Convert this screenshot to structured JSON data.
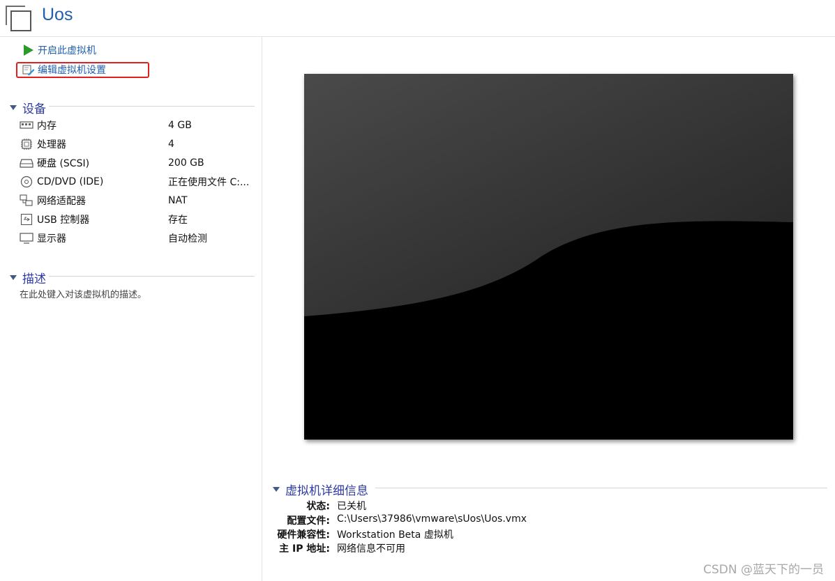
{
  "header": {
    "title": "Uos",
    "icon": "vm-library-icon"
  },
  "actions": [
    {
      "label": "开启此虚拟机",
      "icon": "play-icon"
    },
    {
      "label": "编辑虚拟机设置",
      "icon": "edit-settings-icon",
      "highlighted": true,
      "highlight_color": "#e0201e"
    }
  ],
  "devices": {
    "title": "设备",
    "items": [
      {
        "name": "内存",
        "value": "4 GB",
        "icon": "memory-icon"
      },
      {
        "name": "处理器",
        "value": "4",
        "icon": "cpu-icon"
      },
      {
        "name": "硬盘 (SCSI)",
        "value": "200 GB",
        "icon": "harddisk-icon"
      },
      {
        "name": "CD/DVD (IDE)",
        "value": "正在使用文件 C:...",
        "icon": "cd-dvd-icon"
      },
      {
        "name": "网络适配器",
        "value": "NAT",
        "icon": "network-adapter-icon"
      },
      {
        "name": "USB 控制器",
        "value": "存在",
        "icon": "usb-icon"
      },
      {
        "name": "显示器",
        "value": "自动检测",
        "icon": "monitor-icon"
      }
    ]
  },
  "description": {
    "title": "描述",
    "text": "在此处键入对该虚拟机的描述。"
  },
  "details": {
    "title": "虚拟机详细信息",
    "rows": [
      {
        "label": "状态:",
        "value": "已关机"
      },
      {
        "label": "配置文件:",
        "value": "C:\\Users\\37986\\vmware\\sUos\\Uos.vmx"
      },
      {
        "label": "硬件兼容性:",
        "value": "Workstation Beta 虚拟机"
      },
      {
        "label": "主 IP 地址:",
        "value": "网络信息不可用"
      }
    ]
  },
  "watermark": "CSDN @蓝天下的一员",
  "colors": {
    "accent": "#1f5fae",
    "section": "#2d3aa3",
    "play": "#2e9a2e",
    "highlight": "#e0201e"
  }
}
